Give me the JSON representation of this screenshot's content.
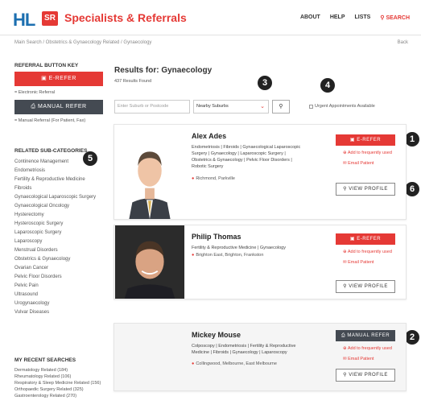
{
  "header": {
    "logo_hl": "HL",
    "logo_sr": "SR",
    "brand": "Specialists & Referrals",
    "nav": [
      "ABOUT",
      "HELP",
      "LISTS"
    ],
    "search_label": "SEARCH"
  },
  "breadcrumb": "Main Search / Obstetrics & Gynaecology Related / Gynaecology",
  "back": "Back",
  "sidebar": {
    "key_heading": "REFERRAL BUTTON KEY",
    "erefer_label": "E-REFER",
    "erefer_note": "= Electronic Referral",
    "manual_label": "MANUAL REFER",
    "manual_note": "= Manual Referral (For Patient, Fax)",
    "subcat_heading": "RELATED SUB-CATEGORIES",
    "subcategories": [
      "Continence Management",
      "Endometriosis",
      "Fertility & Reproductive Medicine",
      "Fibroids",
      "Gynaecological Laparoscopic Surgery",
      "Gynaecological Oncology",
      "Hysterectomy",
      "Hysteroscopic Surgery",
      "Laparoscopic Surgery",
      "Laparoscopy",
      "Menstrual Disorders",
      "Obstetrics & Gynaecology",
      "Ovarian Cancer",
      "Pelvic Floor Disorders",
      "Pelvic Pain",
      "Ultrasound",
      "Urogynaecology",
      "Vulvar Diseases"
    ],
    "recent_heading": "MY RECENT SEARCHES",
    "recent": [
      "Dermatology Related (184)",
      "Rheumatology Related (106)",
      "Respiratory & Sleep Medicine Related (156)",
      "Orthopaedic Surgery Related (325)",
      "Gastroenterology Related (270)"
    ]
  },
  "main": {
    "title": "Results for: Gynaecology",
    "count": "437 Results Found",
    "location_placeholder": "Enter Suburb or Postcode",
    "suburb_option": "Nearby Suburbs",
    "urgent_label": "Urgent Appointments Available"
  },
  "badges": [
    "1",
    "2",
    "3",
    "4",
    "5",
    "6"
  ],
  "results": [
    {
      "name": "Alex Ades",
      "specialties": "Endometriosis | Fibroids | Gynaecological Laparoscopic Surgery | Gynaecology | Laparoscopic Surgery | Obstetrics & Gynaecology | Pelvic Floor Disorders | Robotic Surgery",
      "location": "Richmond, Parkville",
      "button": "E-REFER",
      "add_label": "Add to frequently used",
      "email_label": "Email Patient",
      "profile_label": "VIEW PROFILE"
    },
    {
      "name": "Philip Thomas",
      "specialties": "Fertility & Reproductive Medicine | Gynaecology",
      "location": "Brighton East, Brighton, Frankston",
      "button": "E-REFER",
      "add_label": "Add to frequently used",
      "email_label": "Email Patient",
      "profile_label": "VIEW PROFILE"
    },
    {
      "name": "Mickey Mouse",
      "specialties": "Colposcopy | Endometriosis | Fertility & Reproductive Medicine | Fibroids | Gynaecology | Laparoscopy",
      "location": "Collingwood, Melbourne, East Melbourne",
      "button": "MANUAL REFER",
      "add_label": "Add to frequently used",
      "email_label": "Email Patient",
      "profile_label": "VIEW PROFILE"
    }
  ],
  "colors": {
    "brand_red": "#e53935",
    "brand_blue": "#1c6fb0",
    "manual_grey": "#444a52"
  },
  "icons": [
    "search-icon",
    "monitor-icon",
    "print-icon",
    "map-pin-icon",
    "plus-circle-icon",
    "envelope-icon",
    "chevron-down-icon"
  ]
}
